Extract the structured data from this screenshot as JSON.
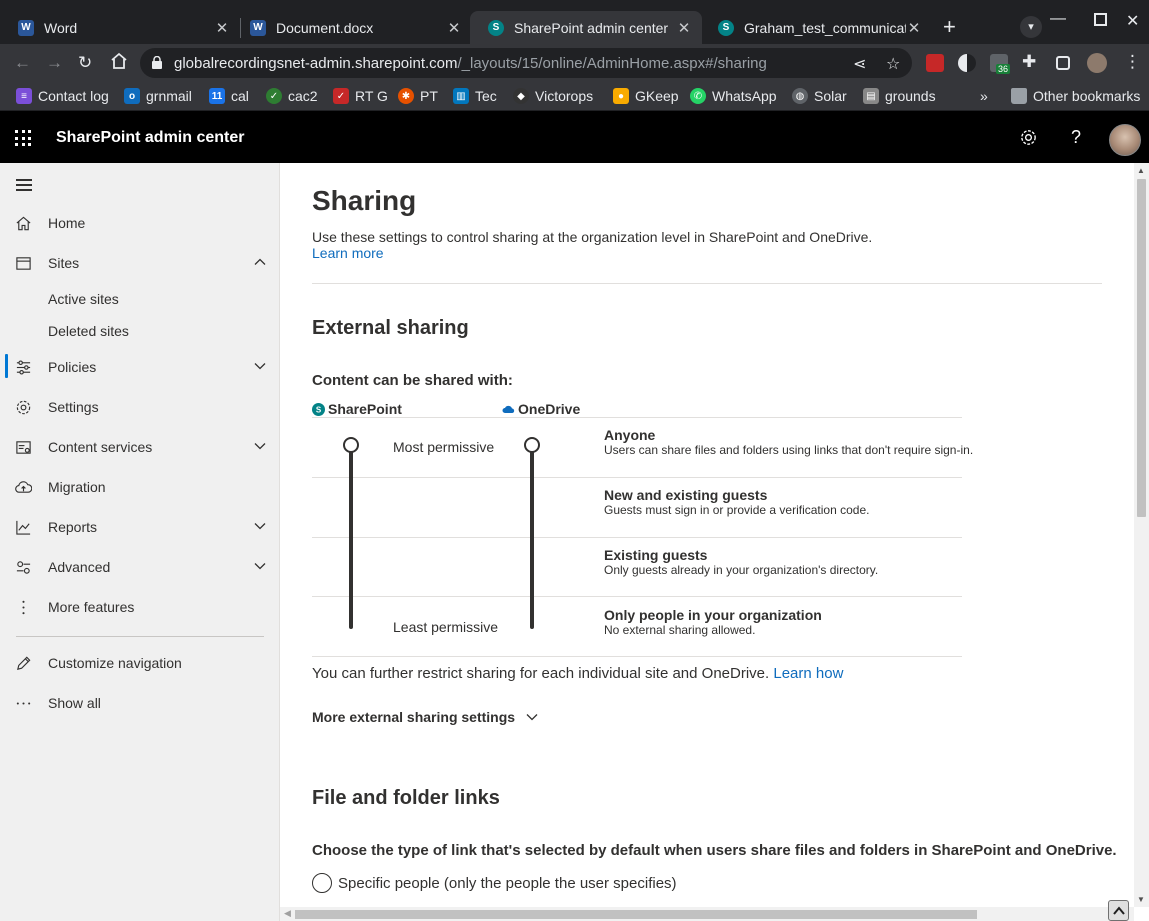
{
  "browser": {
    "tabs": [
      {
        "title": "Word",
        "icon": "word-icon",
        "active": false
      },
      {
        "title": "Document.docx",
        "icon": "word-icon",
        "active": false
      },
      {
        "title": "SharePoint admin center",
        "icon": "sharepoint-icon",
        "active": true
      },
      {
        "title": "Graham_test_communication",
        "icon": "sharepoint-icon",
        "active": false
      }
    ],
    "url_host": "globalrecordingsnet-admin.sharepoint.com",
    "url_path": "/_layouts/15/online/AdminHome.aspx#/sharing",
    "extension_badge": "36",
    "bookmarks": [
      {
        "label": "Contact log",
        "color": "#7b4fd8"
      },
      {
        "label": "grnmail",
        "color": "#0f6cbd"
      },
      {
        "label": "cal",
        "color": "#1a73e8"
      },
      {
        "label": "cac2",
        "color": "#2e7d32"
      },
      {
        "label": "RT G",
        "color": "#c62828"
      },
      {
        "label": "PT",
        "color": "#e65100"
      },
      {
        "label": "Tec",
        "color": "#0277bd"
      },
      {
        "label": "Victorops",
        "color": "#333333"
      },
      {
        "label": "GKeep",
        "color": "#f9ab00"
      },
      {
        "label": "WhatsApp",
        "color": "#25d366"
      },
      {
        "label": "Solar",
        "color": "#5f6368"
      },
      {
        "label": "grounds",
        "color": "#888888"
      }
    ],
    "overflow": "»",
    "other_bookmarks": "Other bookmarks"
  },
  "header": {
    "title": "SharePoint admin center",
    "settings_icon": "gear-icon",
    "help": "?"
  },
  "nav": {
    "items": [
      {
        "label": "Home",
        "icon": "home-icon"
      },
      {
        "label": "Sites",
        "icon": "sites-icon",
        "expanded": true
      },
      {
        "label": "Policies",
        "icon": "policies-icon",
        "selected": true
      },
      {
        "label": "Settings",
        "icon": "settings-icon"
      },
      {
        "label": "Content services",
        "icon": "content-services-icon"
      },
      {
        "label": "Migration",
        "icon": "migration-icon"
      },
      {
        "label": "Reports",
        "icon": "reports-icon"
      },
      {
        "label": "Advanced",
        "icon": "advanced-icon"
      },
      {
        "label": "More features",
        "icon": "more-features-icon"
      }
    ],
    "sites_children": [
      "Active sites",
      "Deleted sites"
    ],
    "customize": "Customize navigation",
    "show_all": "Show all"
  },
  "main": {
    "title": "Sharing",
    "intro": "Use these settings to control sharing at the organization level in SharePoint and OneDrive.",
    "learn_more": "Learn more",
    "external": {
      "heading": "External sharing",
      "content_label": "Content can be shared with:",
      "col_sharepoint": "SharePoint",
      "col_onedrive": "OneDrive",
      "most_permissive": "Most permissive",
      "least_permissive": "Least permissive",
      "options": [
        {
          "title": "Anyone",
          "desc": "Users can share files and folders using links that don't require sign-in."
        },
        {
          "title": "New and existing guests",
          "desc": "Guests must sign in or provide a verification code."
        },
        {
          "title": "Existing guests",
          "desc": "Only guests already in your organization's directory."
        },
        {
          "title": "Only people in your organization",
          "desc": "No external sharing allowed."
        }
      ],
      "restrict_text": "You can further restrict sharing for each individual site and OneDrive.",
      "learn_how": "Learn how",
      "more_settings": "More external sharing settings"
    },
    "links": {
      "heading": "File and folder links",
      "choose": "Choose the type of link that's selected by default when users share files and folders in SharePoint and OneDrive.",
      "option_specific": "Specific people (only the people the user specifies)"
    }
  }
}
